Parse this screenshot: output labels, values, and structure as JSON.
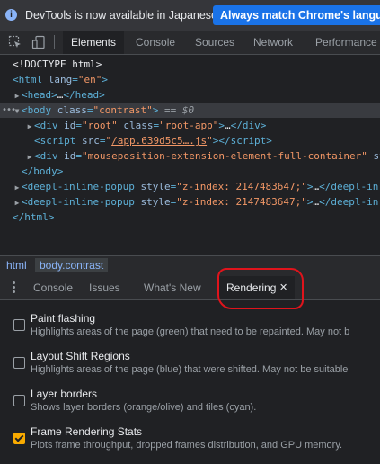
{
  "notification": {
    "message": "DevTools is now available in Japanese!",
    "button": "Always match Chrome's language"
  },
  "main_tabs": [
    "Elements",
    "Console",
    "Sources",
    "Network",
    "Performance"
  ],
  "dom": {
    "doctype": "<!DOCTYPE html>",
    "html_attr": "lang",
    "html_val": "\"en\"",
    "head": "head",
    "body_attr": "class",
    "body_val": "\"contrast\"",
    "body_suffix": "== $0",
    "div_root_id": "\"root\"",
    "div_root_class": "\"root-app\"",
    "script_src": "/app.639d5c5….js",
    "div_mouse_id": "\"mouseposition-extension-element-full-container\"",
    "div_mouse_trail": "st",
    "popup_tag": "deepl-inline-popup",
    "popup_style": "\"z-index: 2147483647;\"",
    "popup_close_trail": "</deepl-in"
  },
  "breadcrumbs": [
    "html",
    "body.contrast"
  ],
  "drawer_tabs": [
    "Console",
    "Issues",
    "What's New",
    "Rendering"
  ],
  "options": [
    {
      "title": "Paint flashing",
      "desc": "Highlights areas of the page (green) that need to be repainted. May not b",
      "checked": false
    },
    {
      "title": "Layout Shift Regions",
      "desc": "Highlights areas of the page (blue) that were shifted. May not be suitable",
      "checked": false
    },
    {
      "title": "Layer borders",
      "desc": "Shows layer borders (orange/olive) and tiles (cyan).",
      "checked": false
    },
    {
      "title": "Frame Rendering Stats",
      "desc": "Plots frame throughput, dropped frames distribution, and GPU memory.",
      "checked": true
    }
  ]
}
